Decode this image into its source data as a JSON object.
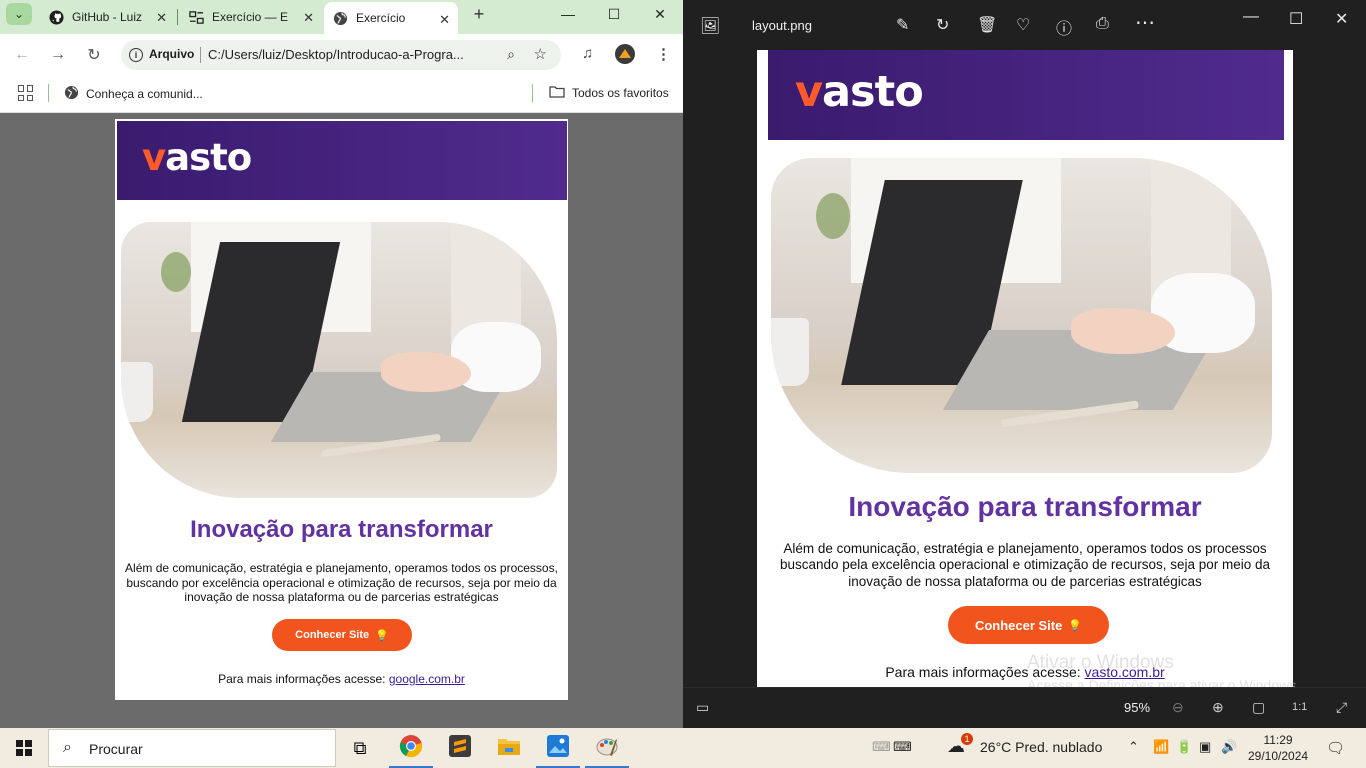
{
  "browser": {
    "tabs": [
      {
        "label": "GitHub - Luiz",
        "icon": "github-icon"
      },
      {
        "label": "Exercício — E",
        "icon": "codepen-icon"
      },
      {
        "label": "Exercício",
        "icon": "globe-icon",
        "active": true
      }
    ],
    "address": {
      "chip": "Arquivo",
      "url": "C:/Users/luiz/Desktop/Introducao-a-Progra..."
    },
    "bookmarks": [
      {
        "label": "Conheça a comunid...",
        "icon": "globe-icon"
      },
      {
        "label": "Todos os favoritos",
        "icon": "folder-icon"
      }
    ]
  },
  "page": {
    "logo": {
      "v": "v",
      "rest": "asto"
    },
    "headline": "Inovação para transformar",
    "body": "Além de comunicação, estratégia e planejamento, operamos todos os processos, buscando por excelência operacional e otimização de recursos, seja por meio da inovação de nossa plataforma ou de parcerias estratégicas",
    "cta": "Conhecer Site",
    "more_prefix": "Para mais informações acesse: ",
    "more_link": "google.com.br"
  },
  "viewer": {
    "title": "layout.png",
    "zoom": "95%",
    "reference": {
      "logo": {
        "v": "v",
        "rest": "asto"
      },
      "headline": "Inovação para transformar",
      "body": "Além de comunicação, estratégia e planejamento, operamos todos os processos buscando pela excelência operacional e otimização de recursos, seja por meio da inovação de nossa plataforma ou de parcerias estratégicas",
      "cta": "Conhecer Site",
      "more_prefix": "Para mais informações acesse: ",
      "more_link": "vasto.com.br"
    },
    "watermark_line1": "Ativar o Windows",
    "watermark_line2": "Acesse a Definições para ativar o Windows."
  },
  "taskbar": {
    "search_placeholder": "Procurar",
    "weather": "26°C  Pred. nublado",
    "time": "11:29",
    "date": "29/10/2024",
    "weather_badge": "1"
  },
  "colors": {
    "accent_purple": "#6232a0",
    "header_purple": "#3a1b6e",
    "brand_orange": "#f2541d"
  }
}
